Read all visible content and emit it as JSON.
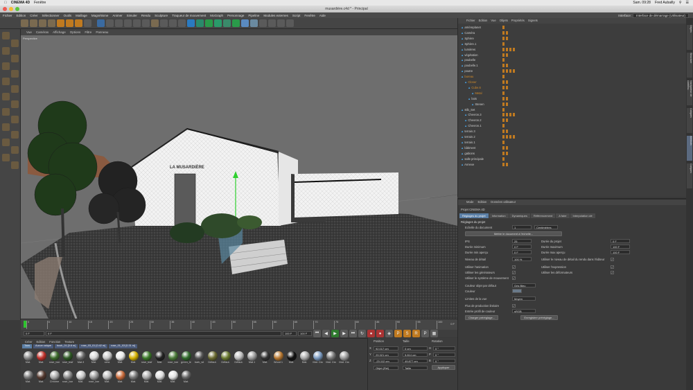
{
  "mac": {
    "app": "CINEMA 4D",
    "menu": "Fenêtre",
    "clock": "Sam. 09:28",
    "user": "Fred Aubailly"
  },
  "window": {
    "title": "musardière.c4d * - Principal"
  },
  "menubar": [
    "Fichier",
    "Edition",
    "Créer",
    "Sélectionner",
    "Outils",
    "Maillage",
    "Magnétisme",
    "Animer",
    "Simuler",
    "Rendu",
    "Sculpture",
    "Traqueur de mouvement",
    "MoGraph",
    "Personnage",
    "Pipeline",
    "Modules externes",
    "Script",
    "Fenêtre",
    "Aide"
  ],
  "interface": {
    "label": "Interface:",
    "value": "Interface de démarrage (Utilisateur)"
  },
  "viewport": {
    "menu": [
      "Vue",
      "Caméras",
      "Affichage",
      "Options",
      "Filtre",
      "Panneau"
    ],
    "label": "Perspective",
    "sign_text": "LA MUSARDIÈRE"
  },
  "timeline": {
    "ticks": [
      "0",
      "5",
      "10",
      "15",
      "20",
      "25",
      "30",
      "35",
      "40",
      "45",
      "50",
      "55",
      "60",
      "65",
      "70",
      "75",
      "80",
      "85",
      "90",
      "95",
      "100"
    ],
    "end_label": "0 F"
  },
  "transport": {
    "start": "0 F",
    "current": "0 F",
    "end_a": "100 F",
    "end_b": "100 F"
  },
  "materials": {
    "menu": [
      "Créer",
      "Edition",
      "Fonction",
      "Texture"
    ],
    "filters": [
      "Tous",
      "Aucun calque",
      "bush_01 [0.6 m]",
      "rose_03_01 [0.42 m]",
      "rose_01_03 [0.31 m]"
    ],
    "row1": [
      {
        "name": "Mat.",
        "color": "#888"
      },
      {
        "name": "Mat.",
        "color": "#c0302a"
      },
      {
        "name": "rose_bar",
        "color": "#3d6b2c"
      },
      {
        "name": "rose_leaf",
        "color": "#2f5a25"
      },
      {
        "name": "Mat.3",
        "color": "#666"
      },
      {
        "name": "Mat.",
        "color": "#d8d8d8"
      },
      {
        "name": "sera",
        "color": "#c8c8c8"
      },
      {
        "name": "Mat.",
        "color": "#e8e8e8"
      },
      {
        "name": "Mat.",
        "color": "#d4b000"
      },
      {
        "name": "rose_leaf",
        "color": "#3a7a28"
      },
      {
        "name": "Mat.",
        "color": "#222"
      },
      {
        "name": "rose_bar",
        "color": "#4a7a38"
      },
      {
        "name": "green_le",
        "color": "#2f6a2a"
      },
      {
        "name": "bark_wt",
        "color": "#555"
      },
      {
        "name": "Défaut.",
        "color": "#6a6a30"
      },
      {
        "name": "Défaut.",
        "color": "#6a7a30"
      },
      {
        "name": "Défaut.",
        "color": "#bbb"
      },
      {
        "name": "Mat.1",
        "color": "#999"
      },
      {
        "name": "Mat.",
        "color": "#333"
      },
      {
        "name": "Wood 1",
        "color": "#b87830"
      },
      {
        "name": "Mat.",
        "color": "#111"
      },
      {
        "name": "Mat.",
        "color": "#aaa"
      },
      {
        "name": "Mat. Cla",
        "color": "#7a9ac0"
      },
      {
        "name": "Mat. Cla",
        "color": "#777"
      },
      {
        "name": "Mat. Cla",
        "color": "#999"
      }
    ],
    "row2": [
      {
        "name": "Mat.",
        "color": "#777"
      },
      {
        "name": "Mat.",
        "color": "#553a30"
      },
      {
        "name": "Chrome",
        "color": "#aaa"
      },
      {
        "name": "rose_bar",
        "color": "#888"
      },
      {
        "name": "Mat.",
        "color": "#c8c8c8"
      },
      {
        "name": "rose_bar",
        "color": "#999"
      },
      {
        "name": "Mat.",
        "color": "#bbb"
      },
      {
        "name": "Mat.",
        "color": "#c86a3a"
      },
      {
        "name": "Mat.",
        "color": "#777"
      },
      {
        "name": "Mat.",
        "color": "#aaa"
      },
      {
        "name": "Mat.",
        "color": "#ddd"
      },
      {
        "name": "Mat.",
        "color": "#e0e0e0"
      },
      {
        "name": "Mat.",
        "color": "#666"
      }
    ]
  },
  "coords": {
    "headers": [
      "Position",
      "Taille",
      "Rotation"
    ],
    "rows": [
      {
        "axis": "X",
        "pos": "92.017 cm",
        "size": "0 cm",
        "rot_label": "H",
        "rot": "0 °"
      },
      {
        "axis": "Y",
        "pos": "29.321 cm",
        "size": "5.814 cm",
        "rot_label": "P",
        "rot": "0 °"
      },
      {
        "axis": "Z",
        "pos": "-23.112 cm",
        "size": "49.877 cm",
        "rot_label": "B",
        "rot": "0 °"
      }
    ],
    "mode": "Objet (Rel)",
    "size_mode": "Taille",
    "apply": "Appliquer"
  },
  "objects": {
    "menu": [
      "Fichier",
      "Edition",
      "Vue",
      "Objets",
      "Propriétés",
      "Signets"
    ],
    "items": [
      {
        "name": "arrièreplanet",
        "indent": 0,
        "color": "#cfcfcf"
      },
      {
        "name": "Caméra",
        "indent": 0,
        "color": "#cfcfcf"
      },
      {
        "name": "Sphère",
        "indent": 0,
        "color": "#cfcfcf"
      },
      {
        "name": "Sphère.1",
        "indent": 0,
        "color": "#cfcfcf"
      },
      {
        "name": "lumières",
        "indent": 0,
        "color": "#cfcfcf"
      },
      {
        "name": "végétation",
        "indent": 0,
        "color": "#cfcfcf"
      },
      {
        "name": "poubelle",
        "indent": 0,
        "color": "#cfcfcf"
      },
      {
        "name": "poubelle.1",
        "indent": 0,
        "color": "#cfcfcf"
      },
      {
        "name": "poutre",
        "indent": 0,
        "color": "#cfcfcf"
      },
      {
        "name": "bureau",
        "indent": 0,
        "color": "#d08a2a"
      },
      {
        "name": "Cloner",
        "indent": 1,
        "color": "#d08a2a"
      },
      {
        "name": "Cube.6",
        "indent": 2,
        "color": "#d08a2a"
      },
      {
        "name": "Metal",
        "indent": 3,
        "color": "#d08a2a"
      },
      {
        "name": "bois",
        "indent": 2,
        "color": "#cfcfcf"
      },
      {
        "name": "Stenen",
        "indent": 3,
        "color": "#cfcfcf"
      },
      {
        "name": "stlb_Set",
        "indent": 0,
        "color": "#cfcfcf"
      },
      {
        "name": "Chevron.3",
        "indent": 1,
        "color": "#cfcfcf"
      },
      {
        "name": "Chevron.2",
        "indent": 1,
        "color": "#cfcfcf"
      },
      {
        "name": "Chevron.1",
        "indent": 1,
        "color": "#cfcfcf"
      },
      {
        "name": "terrain.3",
        "indent": 0,
        "color": "#cfcfcf"
      },
      {
        "name": "terrain.2",
        "indent": 0,
        "color": "#cfcfcf"
      },
      {
        "name": "terrain.1",
        "indent": 0,
        "color": "#cfcfcf"
      },
      {
        "name": "bâtiment",
        "indent": 0,
        "color": "#cfcfcf"
      },
      {
        "name": "gabions",
        "indent": 0,
        "color": "#cfcfcf"
      },
      {
        "name": "salle principale",
        "indent": 0,
        "color": "#cfcfcf"
      },
      {
        "name": "Annexe",
        "indent": 0,
        "color": "#cfcfcf"
      }
    ]
  },
  "attributes": {
    "menu": [
      "Mode",
      "Edition",
      "Données utilisateur"
    ],
    "heading": "Projet CINEMA 4D",
    "tabs": [
      "Réglages du projet",
      "Information",
      "Dynamiques",
      "Référencement",
      "A faire",
      "Interpolation clé"
    ],
    "section": "Réglages du projet",
    "scale_label": "Echelle du document",
    "scale_value": "1",
    "scale_unit": "Centimètres",
    "scale_button": "Mettre le document à l'échelle...",
    "fps_label": "IPS",
    "fps": "25",
    "duration_label": "Durée du projet",
    "duration": "0 F",
    "min_label": "Durée minimum",
    "min": "0 F",
    "max_label": "Durée maximum",
    "max": "100 F",
    "min_preview_label": "Durée min aperçu",
    "min_preview": "0 F",
    "max_preview_label": "Durée max aperçu",
    "max_preview": "100 F",
    "lod_label": "Niveau de détail",
    "lod": "100 %",
    "lod_render_label": "Utiliser le niveau de détail du rendu dans l'éditeur",
    "use_anim": "Utiliser l'animation",
    "use_expr": "Utiliser l'expression",
    "use_gen": "Utiliser les générateurs",
    "use_deform": "Utiliser les déformateurs",
    "use_motion": "Utiliser le système de mouvement",
    "default_color_label": "Couleur objet par défaut",
    "default_color": "Gris Bleu",
    "color_label": "Couleur",
    "view_clip_label": "Limites de la vue",
    "view_clip": "Moyen",
    "linear_flow": "Flux de production linéaire",
    "color_profile_label": "Entrée profil de couleur",
    "color_profile": "sRGB",
    "load_preset": "Charger préréglage...",
    "save_preset": "Enregistrer préréglage..."
  },
  "side_tabs": [
    "Objets",
    "Structure",
    "Navigateur de contenu",
    "Calques",
    "Attributs",
    "Calques"
  ]
}
